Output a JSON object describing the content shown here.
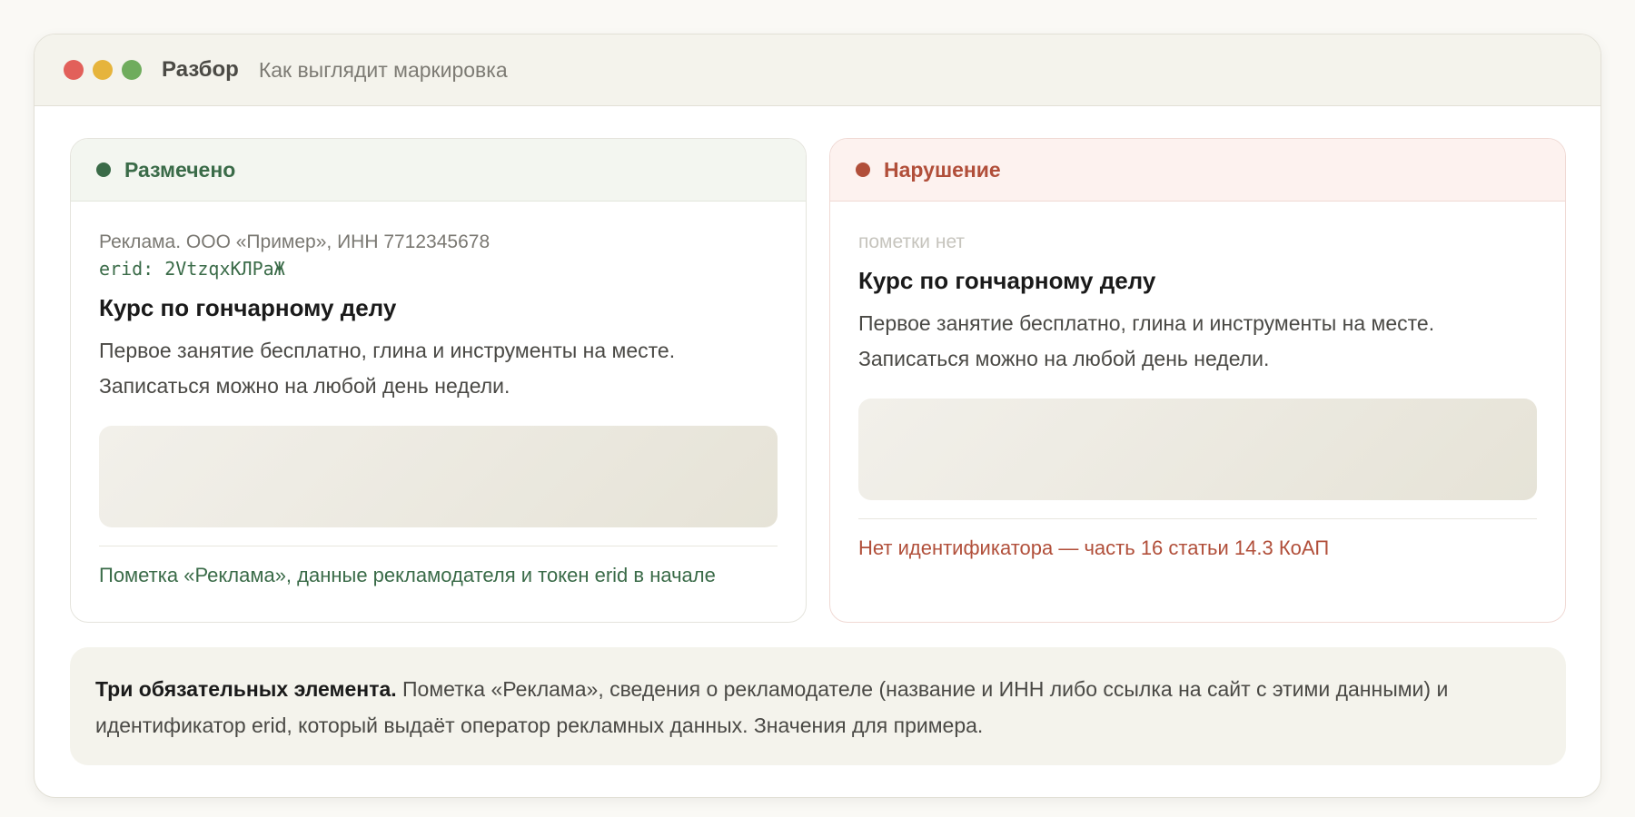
{
  "window": {
    "title": "Разбор",
    "subtitle": "Как выглядит маркировка"
  },
  "marked": {
    "status": "Размечено",
    "disclosure": "Реклама. ООО «Пример», ИНН 7712345678",
    "erid": "erid: 2VtzqxКЛPaЖ",
    "ad_title": "Курс по гончарному делу",
    "ad_text": "Первое занятие бесплатно, глина и инструменты на месте. Записаться можно на любой день недели.",
    "note": "Пометка «Реклама», данные рекламодателя и токен erid в начале"
  },
  "violation": {
    "status": "Нарушение",
    "disclosure": "пометки нет",
    "ad_title": "Курс по гончарному делу",
    "ad_text": "Первое занятие бесплатно, глина и инструменты на месте. Записаться можно на любой день недели.",
    "note": "Нет идентификатора — часть 16 статьи 14.3 КоАП"
  },
  "summary": {
    "lead": "Три обязательных элемента.",
    "text": " Пометка «Реклама», сведения о рекламодателе (название и ИНН либо ссылка на сайт с этими данными) и идентификатор erid, который выдаёт оператор рекламных данных. Значения для примера."
  },
  "colors": {
    "ok": "#3a6b48",
    "bad": "#b14f3a",
    "close": "#e2605a",
    "minimize": "#e6b43c",
    "maximize": "#6fac5d"
  }
}
